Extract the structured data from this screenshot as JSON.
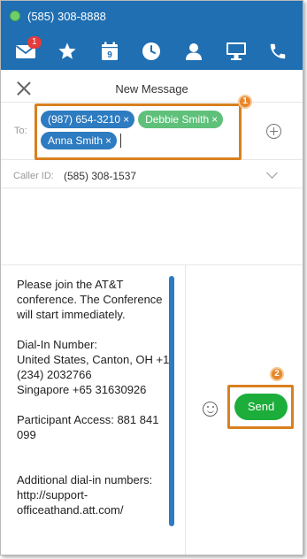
{
  "status": {
    "phone_number": "(585) 308-8888"
  },
  "nav": {
    "badge_count": "1",
    "items": [
      "messages-icon",
      "star-icon",
      "calendar-icon",
      "clock-icon",
      "contacts-icon",
      "monitor-icon",
      "phone-icon"
    ],
    "calendar_day": "9"
  },
  "header": {
    "title": "New Message"
  },
  "recipients": {
    "to_label": "To:",
    "chips": [
      {
        "label": "(987) 654-3210",
        "remove": "×",
        "color": "#2d7bc0"
      },
      {
        "label": "Debbie Smith",
        "remove": "×",
        "color": "#5fc07a"
      },
      {
        "label": "Anna Smith",
        "remove": "×",
        "color": "#2d7bc0"
      }
    ]
  },
  "caller_id": {
    "label": "Caller ID:",
    "value": "(585) 308-1537"
  },
  "message": {
    "body": "Please join the AT&T conference. The Conference will start immediately.\n\nDial-In Number:\nUnited States, Canton, OH +1 (234) 2032766\nSingapore +65 31630926\n\nParticipant Access: 881 841 099\n\n\nAdditional dial-in numbers: http://support-officeathand.att.com/"
  },
  "actions": {
    "send_label": "Send"
  },
  "annotations": {
    "marker_1": "1",
    "marker_2": "2"
  },
  "colors": {
    "header_bg": "#1f6fb2",
    "accent_blue": "#2d7bc0",
    "accent_green": "#5fc07a",
    "send_green": "#1cad3a",
    "highlight_orange": "#d8801f",
    "badge_red": "#e23b3b"
  }
}
